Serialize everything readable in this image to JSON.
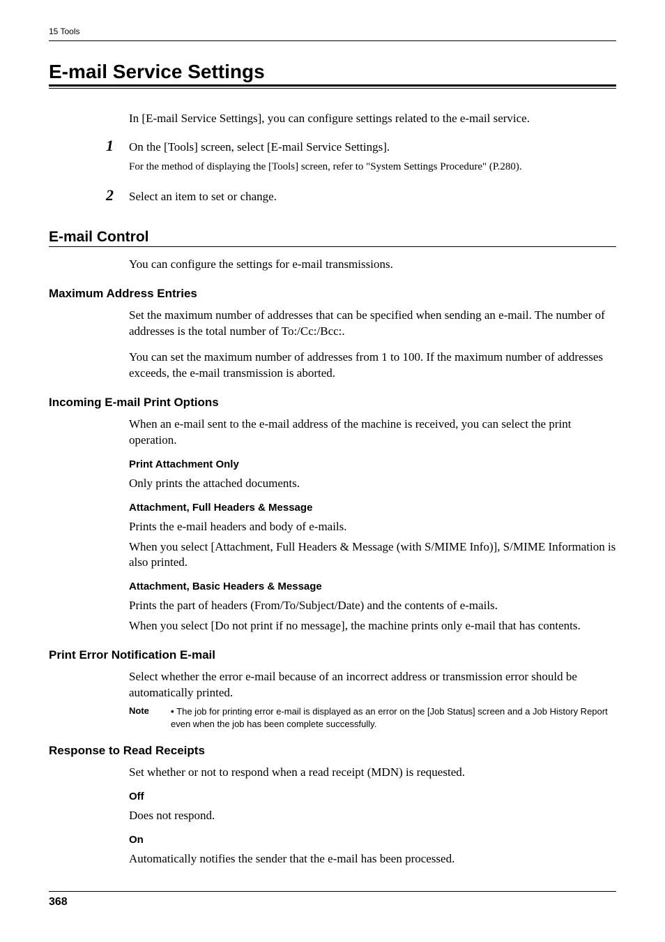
{
  "header": {
    "label": "15 Tools"
  },
  "h1": "E-mail Service Settings",
  "intro": "In [E-mail Service Settings], you can configure settings related to the e-mail service.",
  "step1": {
    "n": "1",
    "text": "On the [Tools] screen, select [E-mail Service Settings].",
    "sub": "For the method of displaying the [Tools] screen, refer to \"System Settings Procedure\" (P.280)."
  },
  "step2": {
    "n": "2",
    "text": "Select an item to set or change."
  },
  "h2_control": "E-mail Control",
  "control_intro": "You can configure the settings for e-mail transmissions.",
  "max_addr": {
    "title": "Maximum Address Entries",
    "p1": "Set the maximum number of addresses that can be specified when sending an e-mail. The number of addresses is the total number of To:/Cc:/Bcc:.",
    "p2": "You can set the maximum number of addresses from 1 to 100. If the maximum number of addresses exceeds, the e-mail transmission is aborted."
  },
  "incoming": {
    "title": "Incoming E-mail Print Options",
    "p1": "When an e-mail sent to the e-mail address of the machine is received, you can select the print operation.",
    "opt1": {
      "title": "Print Attachment Only",
      "p": "Only prints the attached documents."
    },
    "opt2": {
      "title": "Attachment, Full Headers & Message",
      "p1": "Prints the e-mail headers and body of e-mails.",
      "p2": "When you select [Attachment, Full Headers & Message (with S/MIME Info)], S/MIME Information is also printed."
    },
    "opt3": {
      "title": "Attachment, Basic Headers & Message",
      "p1": "Prints the part of headers (From/To/Subject/Date) and the contents of e-mails.",
      "p2": "When you select [Do not print if no message], the machine prints only e-mail that has contents."
    }
  },
  "print_err": {
    "title": "Print Error Notification E-mail",
    "p": "Select whether the error e-mail because of an incorrect address or transmission error should be automatically printed.",
    "note_label": "Note",
    "note_text": "The job for printing error e-mail is displayed as an error on the [Job Status] screen and a Job History Report even when the job has been complete successfully."
  },
  "read_rcpt": {
    "title": "Response to Read Receipts",
    "p": "Set whether or not to respond when a read receipt (MDN) is requested.",
    "off": {
      "title": "Off",
      "p": "Does not respond."
    },
    "on": {
      "title": "On",
      "p": "Automatically notifies the sender that the e-mail has been processed."
    }
  },
  "page": "368"
}
